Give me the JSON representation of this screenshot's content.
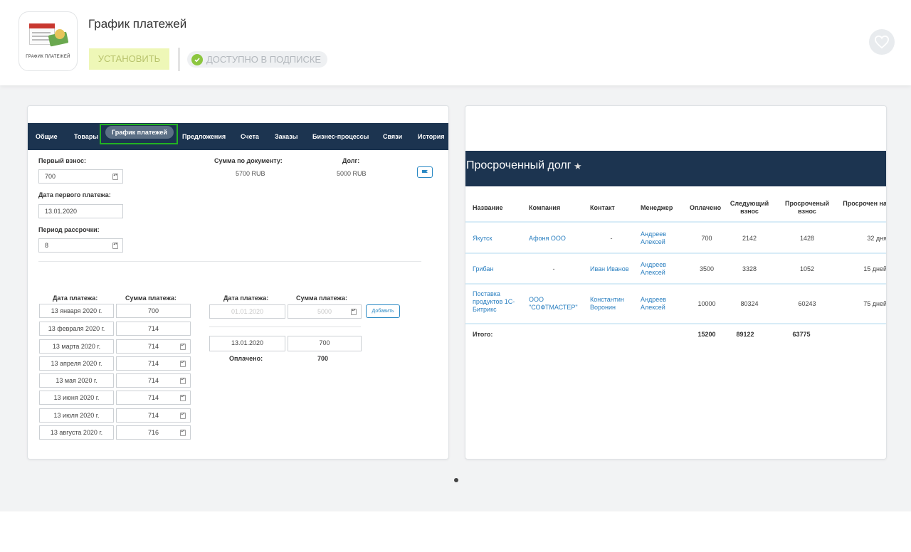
{
  "app": {
    "title": "График платежей",
    "icon_text": "ГРАФИК ПЛАТЕЖЕЙ",
    "install_label": "УСТАНОВИТЬ",
    "subscription_label": "ДОСТУПНО В ПОДПИСКЕ"
  },
  "colors": {
    "nav_bg": "#1c3450",
    "accent_green": "#22b222",
    "link_blue": "#2a7fc0",
    "install_bg": "#eef7b7",
    "check_green": "#8cc63f"
  },
  "left_card": {
    "tabs": [
      "Общие",
      "Товары",
      "График платежей",
      "Предложения",
      "Счета",
      "Заказы",
      "Бизнес-процессы",
      "Связи",
      "История"
    ],
    "active_tab": "График платежей",
    "first_payment_label": "Первый взнос:",
    "first_payment_value": "700",
    "first_date_label": "Дата первого платежа:",
    "first_date_value": "13.01.2020",
    "period_label": "Период рассрочки:",
    "period_value": "8",
    "doc_sum_label": "Сумма по документу:",
    "doc_sum_value": "5700 RUB",
    "debt_label": "Долг:",
    "debt_value": "5000 RUB",
    "schedule_date_header": "Дата платежа:",
    "schedule_sum_header": "Сумма платежа:",
    "schedule": [
      {
        "date": "13 января 2020 г.",
        "sum": "700"
      },
      {
        "date": "13 февраля 2020 г.",
        "sum": "714"
      },
      {
        "date": "13 марта 2020 г.",
        "sum": "714"
      },
      {
        "date": "13 апреля 2020 г.",
        "sum": "714"
      },
      {
        "date": "13 мая 2020 г.",
        "sum": "714"
      },
      {
        "date": "13 июня 2020 г.",
        "sum": "714"
      },
      {
        "date": "13 июля 2020 г.",
        "sum": "714"
      },
      {
        "date": "13 августа 2020 г.",
        "sum": "716"
      }
    ],
    "pay_date_header": "Дата платежа:",
    "pay_sum_header": "Сумма платежа:",
    "new_date_placeholder": "01.01.2020",
    "new_sum_placeholder": "5000",
    "add_label": "Добавить",
    "paid_date": "13.01.2020",
    "paid_sum": "700",
    "paid_label": "Оплачено:",
    "paid_total": "700"
  },
  "right_card": {
    "title": "Просроченный долг",
    "headers": [
      "Название",
      "Компания",
      "Контакт",
      "Менеджер",
      "Оплачено",
      "Следующий взнос",
      "Просроченый взнос",
      "Просрочен на"
    ],
    "rows": [
      {
        "name": "Якутск",
        "company": "Афоня ООО",
        "contact": "-",
        "manager": "Андреев Алексей",
        "paid": "700",
        "next": "2142",
        "overdue": "1428",
        "days": "32 дня"
      },
      {
        "name": "Грибан",
        "company": "-",
        "contact": "Иван Иванов",
        "manager": "Андреев Алексей",
        "paid": "3500",
        "next": "3328",
        "overdue": "1052",
        "days": "15 дней"
      },
      {
        "name": "Поставка продуктов 1С-Битрикс",
        "company": "ООО \"СОФТМАСТЕР\"",
        "contact": "Константин Воронин",
        "manager": "Андреев Алексей",
        "paid": "10000",
        "next": "80324",
        "overdue": "60243",
        "days": "75 дней"
      }
    ],
    "total_label": "Итого:",
    "total_paid": "15200",
    "total_next": "89122",
    "total_overdue": "63775"
  }
}
